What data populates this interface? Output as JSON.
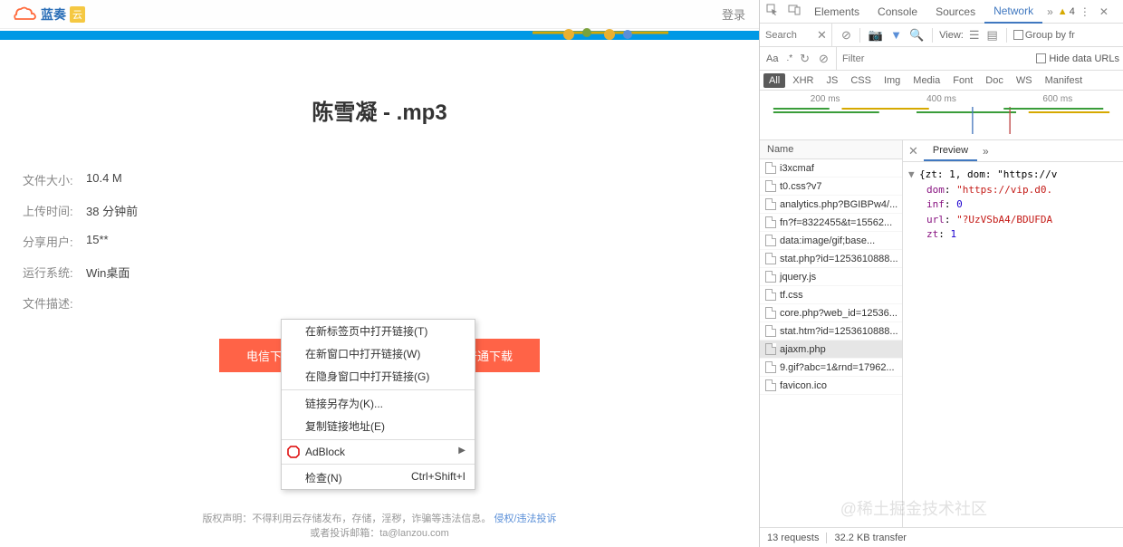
{
  "header": {
    "brand": "蓝奏",
    "brand_suffix": "云",
    "login": "登录"
  },
  "page": {
    "title": "陈雪凝 - .mp3",
    "info": [
      {
        "label": "文件大小:",
        "value": "10.4 M"
      },
      {
        "label": "上传时间:",
        "value": "38 分钟前"
      },
      {
        "label": "分享用户:",
        "value": "15**"
      },
      {
        "label": "运行系统:",
        "value": "Win桌面"
      },
      {
        "label": "文件描述:",
        "value": ""
      }
    ],
    "buttons": {
      "telecom": "电信下载",
      "mobile": "",
      "normal": "普通下载"
    }
  },
  "context_menu": {
    "open_new_tab": "在新标签页中打开链接(T)",
    "open_new_window": "在新窗口中打开链接(W)",
    "open_incognito": "在隐身窗口中打开链接(G)",
    "save_as": "链接另存为(K)...",
    "copy_address": "复制链接地址(E)",
    "adblock": "AdBlock",
    "inspect": "检查(N)",
    "inspect_shortcut": "Ctrl+Shift+I"
  },
  "footer": {
    "line1_prefix": "版权声明：不得利用云存储发布，存储，淫秽，诈骗等违法信息。",
    "link": "侵权/违法投诉",
    "line2": "或者投诉邮箱：ta@lanzou.com"
  },
  "devtools": {
    "tabs": {
      "elements": "Elements",
      "console": "Console",
      "sources": "Sources",
      "network": "Network"
    },
    "warn_count": "4",
    "search": {
      "placeholder": "Search"
    },
    "view_label": "View:",
    "group_by": "Group by fr",
    "filter": {
      "placeholder": "Filter",
      "hide_urls": "Hide data URLs",
      "aa": "Aa"
    },
    "types": [
      "All",
      "XHR",
      "JS",
      "CSS",
      "Img",
      "Media",
      "Font",
      "Doc",
      "WS",
      "Manifest"
    ],
    "timeline_labels": [
      "200 ms",
      "400 ms",
      "600 ms"
    ],
    "name_header": "Name",
    "requests": [
      "i3xcmaf",
      "t0.css?v7",
      "analytics.php?BGIBPw4/...",
      "fn?f=8322455&t=15562...",
      "data:image/gif;base...",
      "stat.php?id=1253610888...",
      "jquery.js",
      "tf.css",
      "core.php?web_id=12536...",
      "stat.htm?id=1253610888...",
      "ajaxm.php",
      "9.gif?abc=1&rnd=17962...",
      "favicon.ico"
    ],
    "selected_request_index": 10,
    "preview_tab": "Preview",
    "json": {
      "summary": "{zt: 1, dom: \"https://v",
      "dom": "\"https://vip.d0.",
      "inf": "0",
      "url": "\"?UzVSbA4/BDUFDA",
      "zt": "1"
    },
    "status": {
      "requests": "13 requests",
      "transfer": "32.2 KB transfer"
    }
  },
  "watermark": "稀土掘金技术社区"
}
